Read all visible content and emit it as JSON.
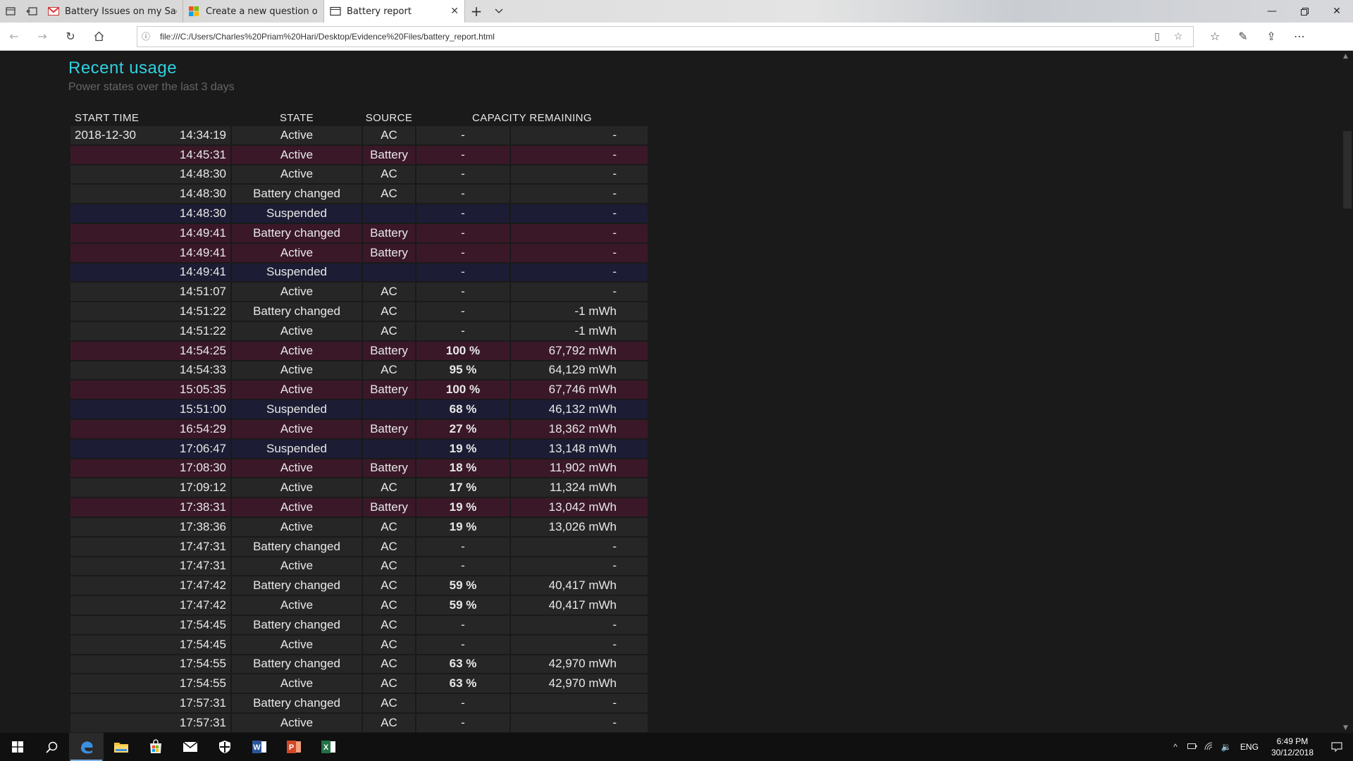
{
  "browser": {
    "tabs": [
      {
        "label": "Battery Issues on my Sager",
        "icon": "gmail-icon"
      },
      {
        "label": "Create a new question or st",
        "icon": "microsoft-icon"
      },
      {
        "label": "Battery report",
        "icon": "page-icon",
        "active": true
      }
    ],
    "url": "file:///C:/Users/Charles%20Priam%20Hari/Desktop/Evidence%20Files/battery_report.html"
  },
  "page": {
    "title": "Recent usage",
    "subtitle": "Power states over the last 3 days",
    "columns": [
      "START TIME",
      "STATE",
      "SOURCE",
      "CAPACITY REMAINING"
    ],
    "rows": [
      {
        "date": "2018-12-30",
        "time": "14:34:19",
        "state": "Active",
        "source": "AC",
        "pct": "-",
        "cap": "-",
        "kind": "ac"
      },
      {
        "date": "",
        "time": "14:45:31",
        "state": "Active",
        "source": "Battery",
        "pct": "-",
        "cap": "-",
        "kind": "batt"
      },
      {
        "date": "",
        "time": "14:48:30",
        "state": "Active",
        "source": "AC",
        "pct": "-",
        "cap": "-",
        "kind": "ac"
      },
      {
        "date": "",
        "time": "14:48:30",
        "state": "Battery changed",
        "source": "AC",
        "pct": "-",
        "cap": "-",
        "kind": "ac"
      },
      {
        "date": "",
        "time": "14:48:30",
        "state": "Suspended",
        "source": "",
        "pct": "-",
        "cap": "-",
        "kind": "susp"
      },
      {
        "date": "",
        "time": "14:49:41",
        "state": "Battery changed",
        "source": "Battery",
        "pct": "-",
        "cap": "-",
        "kind": "batt"
      },
      {
        "date": "",
        "time": "14:49:41",
        "state": "Active",
        "source": "Battery",
        "pct": "-",
        "cap": "-",
        "kind": "batt"
      },
      {
        "date": "",
        "time": "14:49:41",
        "state": "Suspended",
        "source": "",
        "pct": "-",
        "cap": "-",
        "kind": "susp"
      },
      {
        "date": "",
        "time": "14:51:07",
        "state": "Active",
        "source": "AC",
        "pct": "-",
        "cap": "-",
        "kind": "ac"
      },
      {
        "date": "",
        "time": "14:51:22",
        "state": "Battery changed",
        "source": "AC",
        "pct": "-",
        "cap": "-1 mWh",
        "kind": "ac"
      },
      {
        "date": "",
        "time": "14:51:22",
        "state": "Active",
        "source": "AC",
        "pct": "-",
        "cap": "-1 mWh",
        "kind": "ac"
      },
      {
        "date": "",
        "time": "14:54:25",
        "state": "Active",
        "source": "Battery",
        "pct": "100 %",
        "cap": "67,792 mWh",
        "kind": "batt"
      },
      {
        "date": "",
        "time": "14:54:33",
        "state": "Active",
        "source": "AC",
        "pct": "95 %",
        "cap": "64,129 mWh",
        "kind": "ac"
      },
      {
        "date": "",
        "time": "15:05:35",
        "state": "Active",
        "source": "Battery",
        "pct": "100 %",
        "cap": "67,746 mWh",
        "kind": "batt"
      },
      {
        "date": "",
        "time": "15:51:00",
        "state": "Suspended",
        "source": "",
        "pct": "68 %",
        "cap": "46,132 mWh",
        "kind": "susp"
      },
      {
        "date": "",
        "time": "16:54:29",
        "state": "Active",
        "source": "Battery",
        "pct": "27 %",
        "cap": "18,362 mWh",
        "kind": "batt"
      },
      {
        "date": "",
        "time": "17:06:47",
        "state": "Suspended",
        "source": "",
        "pct": "19 %",
        "cap": "13,148 mWh",
        "kind": "susp"
      },
      {
        "date": "",
        "time": "17:08:30",
        "state": "Active",
        "source": "Battery",
        "pct": "18 %",
        "cap": "11,902 mWh",
        "kind": "batt"
      },
      {
        "date": "",
        "time": "17:09:12",
        "state": "Active",
        "source": "AC",
        "pct": "17 %",
        "cap": "11,324 mWh",
        "kind": "ac"
      },
      {
        "date": "",
        "time": "17:38:31",
        "state": "Active",
        "source": "Battery",
        "pct": "19 %",
        "cap": "13,042 mWh",
        "kind": "batt"
      },
      {
        "date": "",
        "time": "17:38:36",
        "state": "Active",
        "source": "AC",
        "pct": "19 %",
        "cap": "13,026 mWh",
        "kind": "ac"
      },
      {
        "date": "",
        "time": "17:47:31",
        "state": "Battery changed",
        "source": "AC",
        "pct": "-",
        "cap": "-",
        "kind": "ac"
      },
      {
        "date": "",
        "time": "17:47:31",
        "state": "Active",
        "source": "AC",
        "pct": "-",
        "cap": "-",
        "kind": "ac"
      },
      {
        "date": "",
        "time": "17:47:42",
        "state": "Battery changed",
        "source": "AC",
        "pct": "59 %",
        "cap": "40,417 mWh",
        "kind": "ac"
      },
      {
        "date": "",
        "time": "17:47:42",
        "state": "Active",
        "source": "AC",
        "pct": "59 %",
        "cap": "40,417 mWh",
        "kind": "ac"
      },
      {
        "date": "",
        "time": "17:54:45",
        "state": "Battery changed",
        "source": "AC",
        "pct": "-",
        "cap": "-",
        "kind": "ac"
      },
      {
        "date": "",
        "time": "17:54:45",
        "state": "Active",
        "source": "AC",
        "pct": "-",
        "cap": "-",
        "kind": "ac"
      },
      {
        "date": "",
        "time": "17:54:55",
        "state": "Battery changed",
        "source": "AC",
        "pct": "63 %",
        "cap": "42,970 mWh",
        "kind": "ac"
      },
      {
        "date": "",
        "time": "17:54:55",
        "state": "Active",
        "source": "AC",
        "pct": "63 %",
        "cap": "42,970 mWh",
        "kind": "ac"
      },
      {
        "date": "",
        "time": "17:57:31",
        "state": "Battery changed",
        "source": "AC",
        "pct": "-",
        "cap": "-",
        "kind": "ac"
      },
      {
        "date": "",
        "time": "17:57:31",
        "state": "Active",
        "source": "AC",
        "pct": "-",
        "cap": "-",
        "kind": "ac"
      }
    ]
  },
  "colors": {
    "title": "#2fd1e0",
    "row_ac": "#262626",
    "row_battery": "#3a1828",
    "row_suspended": "#1c1c34"
  },
  "taskbar": {
    "apps": [
      "start-icon",
      "search-icon",
      "edge-icon",
      "file-explorer-icon",
      "store-icon",
      "mail-icon",
      "security-icon",
      "word-icon",
      "powerpoint-icon",
      "excel-icon"
    ],
    "lang": "ENG",
    "time": "6:49 PM",
    "date": "30/12/2018"
  }
}
